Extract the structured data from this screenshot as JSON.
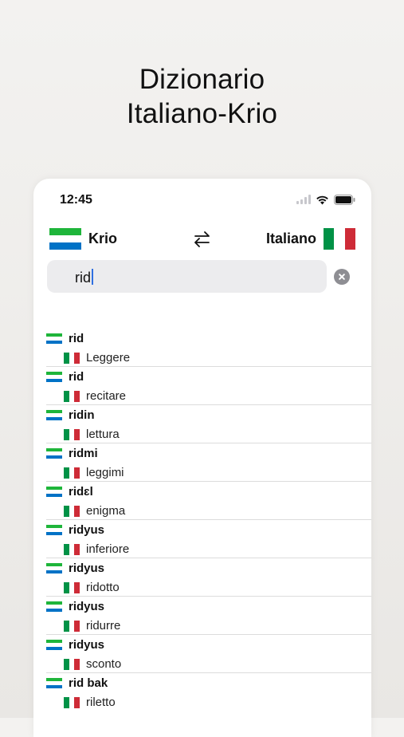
{
  "headline": {
    "line1": "Dizionario",
    "line2": "Italiano-Krio"
  },
  "status_bar": {
    "time": "12:45"
  },
  "language_bar": {
    "source": "Krio",
    "target": "Italiano"
  },
  "search": {
    "value": "rid"
  },
  "colors": {
    "sl_green": "#1eb53a",
    "sl_white": "#ffffff",
    "sl_blue": "#0072c6",
    "it_green": "#009246",
    "it_red": "#ce2b37",
    "caret": "#2f6fe0"
  },
  "results": [
    {
      "krio": "rid",
      "italiano": "Leggere"
    },
    {
      "krio": "rid",
      "italiano": "recitare"
    },
    {
      "krio": "ridin",
      "italiano": "lettura"
    },
    {
      "krio": "ridmi",
      "italiano": "leggimi"
    },
    {
      "krio": "ridɛl",
      "italiano": "enigma"
    },
    {
      "krio": "ridyus",
      "italiano": "inferiore"
    },
    {
      "krio": "ridyus",
      "italiano": "ridotto"
    },
    {
      "krio": "ridyus",
      "italiano": "ridurre"
    },
    {
      "krio": "ridyus",
      "italiano": "sconto"
    },
    {
      "krio": "rid bak",
      "italiano": "riletto"
    }
  ]
}
